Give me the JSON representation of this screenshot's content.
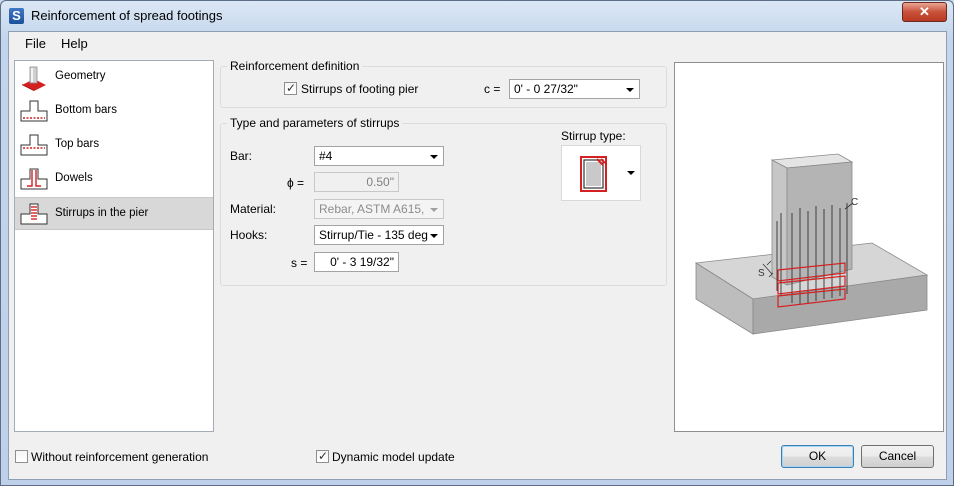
{
  "window": {
    "title": "Reinforcement of spread footings",
    "app_icon_letter": "S",
    "close_glyph": "✕"
  },
  "menu": [
    "File",
    "Help"
  ],
  "nav": {
    "items": [
      {
        "label": "Geometry",
        "icon": "geometry-icon"
      },
      {
        "label": "Bottom bars",
        "icon": "bottom-bars-icon"
      },
      {
        "label": "Top bars",
        "icon": "top-bars-icon"
      },
      {
        "label": "Dowels",
        "icon": "dowels-icon"
      },
      {
        "label": "Stirrups in the pier",
        "icon": "stirrups-icon"
      }
    ],
    "selected": "Stirrups in the pier"
  },
  "reinforcement_definition": {
    "title": "Reinforcement definition",
    "stirrups_checkbox_label": "Stirrups of footing pier",
    "stirrups_checked": true,
    "c_label": "c =",
    "c_value": "0' - 0 27/32\""
  },
  "stirrup_params": {
    "title": "Type and parameters of stirrups",
    "bar_label": "Bar:",
    "bar_value": "#4",
    "phi_label": "ϕ =",
    "phi_value": "0.50\"",
    "material_label": "Material:",
    "material_value": "Rebar, ASTM A615,",
    "hooks_label": "Hooks:",
    "hooks_value": "Stirrup/Tie - 135 deg",
    "s_label": "s =",
    "s_value": "0' - 3 19/32\"",
    "stirrup_type_label": "Stirrup type:"
  },
  "preview": {
    "label_c": "C",
    "label_s": "S"
  },
  "footer": {
    "without_generation_label": "Without reinforcement generation",
    "without_generation_checked": false,
    "dynamic_update_label": "Dynamic model update",
    "dynamic_update_checked": true,
    "ok_label": "OK",
    "cancel_label": "Cancel"
  },
  "colors": {
    "accent_red": "#d42020",
    "selection_bg": "#d8d8d8"
  }
}
